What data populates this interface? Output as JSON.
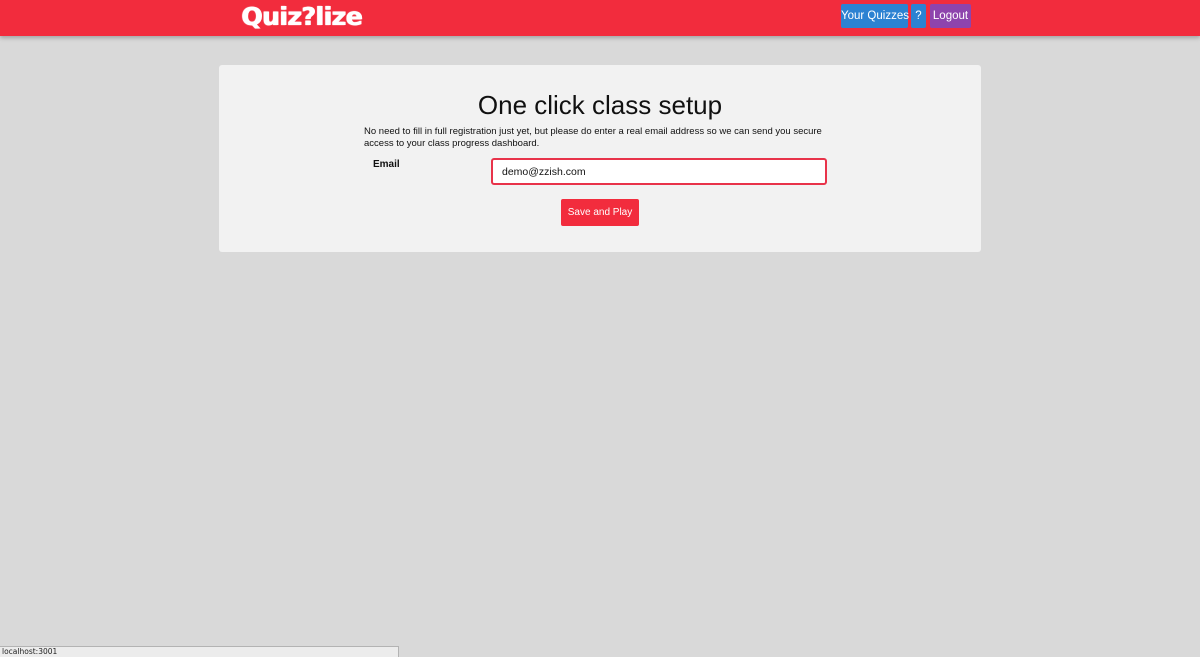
{
  "header": {
    "logo_text": "Quiz?lize",
    "brand_color": "#f22c3d",
    "nav": {
      "your_quizzes_label": "Your Quizzes",
      "help_label": "?",
      "logout_label": "Logout"
    }
  },
  "setup": {
    "title": "One click class setup",
    "description": "No need to fill in full registration just yet, but please do enter a real email address so we can send you secure access to your class progress dashboard.",
    "email_label": "Email",
    "email_value": "demo@zzish.com",
    "submit_label": "Save and Play"
  },
  "statusbar": {
    "url": "localhost:3001"
  }
}
